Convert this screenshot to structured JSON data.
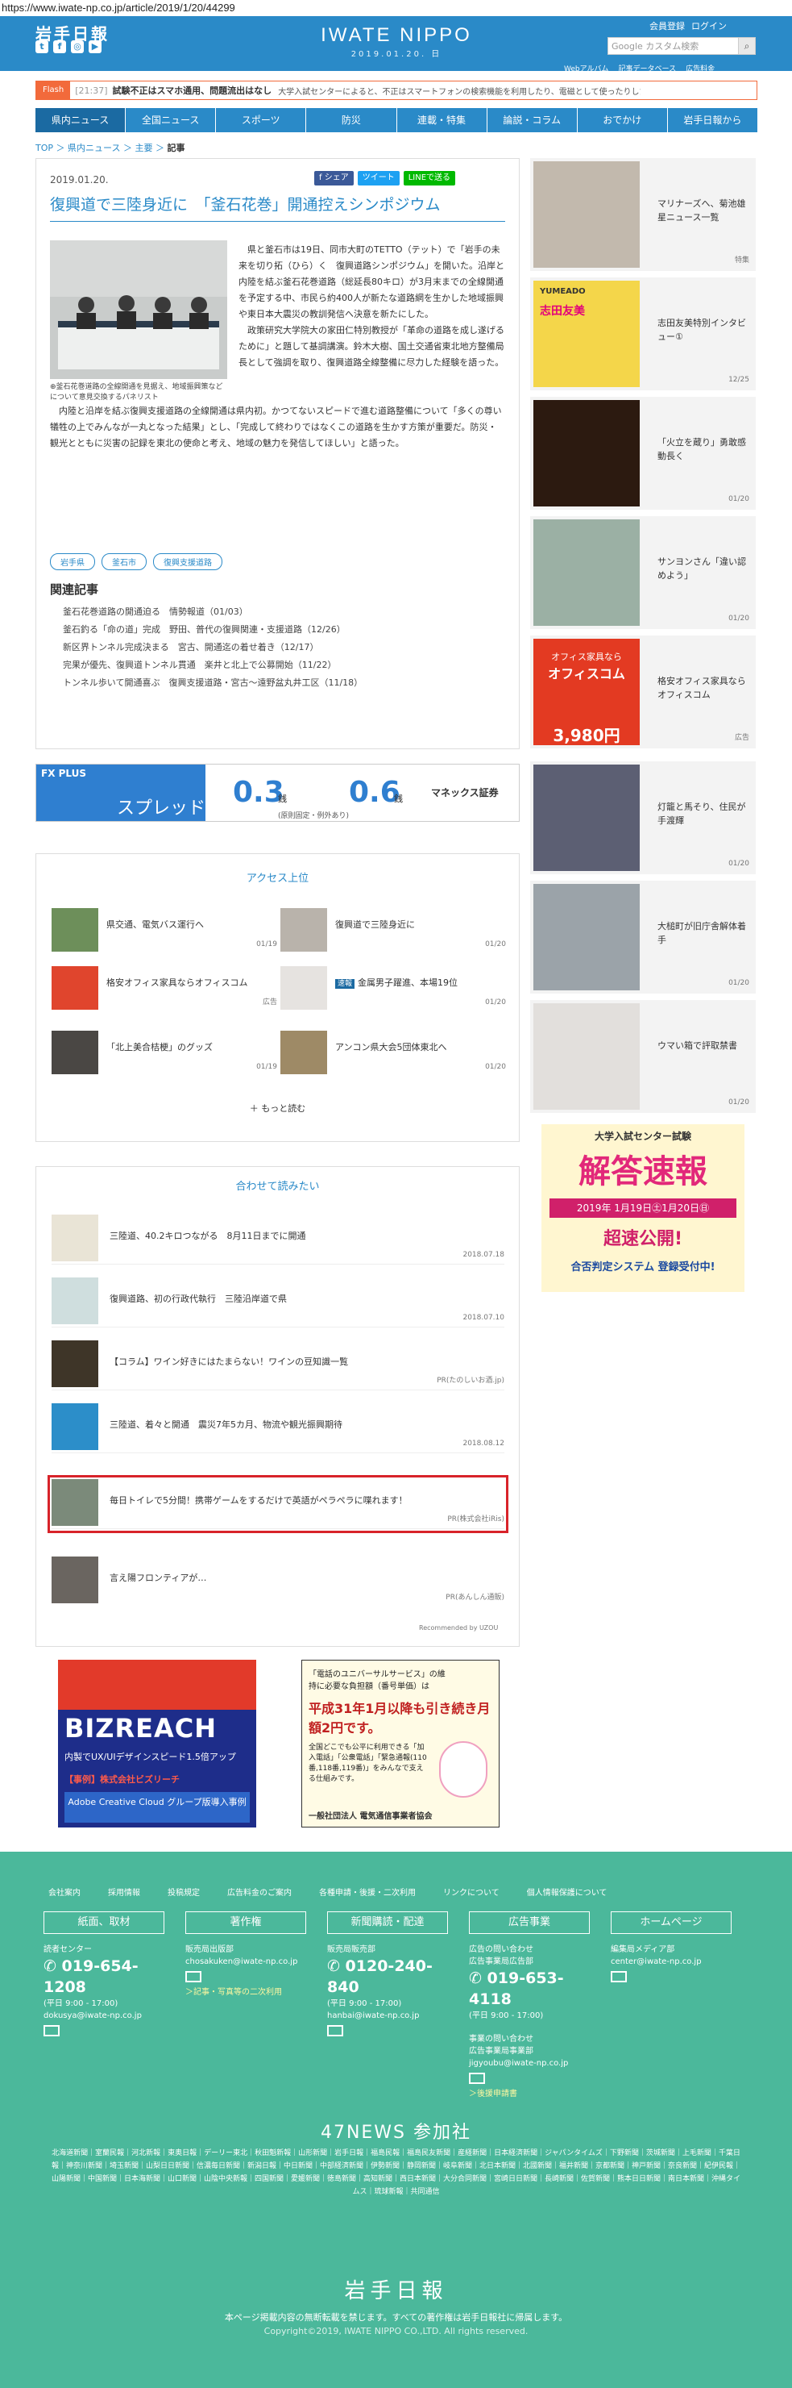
{
  "url_bar": "https://www.iwate-np.co.jp/article/2019/1/20/44299",
  "header": {
    "logo": "岩手日報",
    "site_logo": "IWATE NIPPO",
    "date": "2019.01.20. 日",
    "member": "会員登録",
    "login": "ログイン",
    "search_placeholder": "Google カスタム検索",
    "sub_links": [
      "Webアルバム",
      "記事データベース",
      "広告料金"
    ]
  },
  "flash": {
    "label": "Flash",
    "time": "[21:37]",
    "text": "試験不正はスマホ通用、問題流出はなし",
    "sub": "大学入試センターによると、不正はスマートフォンの検索機能を利用したり、電磁として使ったりしたもので、問題…"
  },
  "nav": [
    "県内ニュース",
    "全国ニュース",
    "スポーツ",
    "防災",
    "連載・特集",
    "論説・コラム",
    "おでかけ",
    "岩手日報から"
  ],
  "breadcrumb": {
    "top": "TOP",
    "l1": "県内ニュース",
    "l2": "主要",
    "cur": "記事"
  },
  "article": {
    "date": "2019.01.20.",
    "share_fb": "f シェア",
    "share_tw": "ツイート",
    "share_line": "LINEで送る",
    "title": "復興道で三陸身近に　「釜石花巻」開通控えシンポジウム",
    "caption": "釜石花巻道路の全線開通を見据え、地域振興策などについて意見交換するパネリスト",
    "body1": "県と釜石市は19日、同市大町のTETTO（テット）で「岩手の未来を切り拓（ひら）く　復興道路シンポジウム」を開いた。沿岸と内陸を結ぶ釜石花巻道路（総延長80キロ）が3月末までの全線開通を予定する中、市民ら約400人が新たな道路網を生かした地域振興や東日本大震災の教訓発信へ決意を新たにした。",
    "body1b": "政策研究大学院大の家田仁特別教授が「革命の道路を成し遂げるために」と題して基調講演。鈴木大樹、国土交通省東北地方整備局長として強調を取り、復興道路全線整備に尽力した経験を語った。",
    "body2": "内陸と沿岸を結ぶ復興支援道路の全線開通は県内初。かつてないスピードで進む道路整備について「多くの尊い犠牲の上でみんなが一丸となった結果」とし、「完成して終わりではなくこの道路を生かす方策が重要だ。防災・観光とともに災害の記録を東北の使命と考え、地域の魅力を発信してほしい」と語った。",
    "tags": [
      "岩手県",
      "釜石市",
      "復興支援道路"
    ],
    "related_title": "関連記事",
    "related": [
      "釜石花巻道路の開通迫る　情勢報道（01/03）",
      "釜石釣る「命の道」完成　野田、普代の復興関連・支援道路（12/26）",
      "新区界トンネル完成決まる　宮古、開通迄の着せ着き（12/17）",
      "完果が優先、復興道トンネル貫通　楽井と北上で公募開始（11/22）",
      "トンネル歩いて開通喜ぶ　復興支援道路・宮古～遠野盆丸井工区（11/18）"
    ]
  },
  "fx_ad": {
    "brand": "FX PLUS",
    "word": "スプレッド",
    "usd": "0.3",
    "eur": "0.6",
    "unit": "銭",
    "note": "(原則固定・例外あり)",
    "sec": "マネックス証券"
  },
  "access": {
    "title": "アクセス上位",
    "items": [
      {
        "t": "県交通、電気バス運行へ",
        "d": "01/19"
      },
      {
        "t": "復興道で三陸身近に",
        "d": "01/20"
      },
      {
        "t": "格安オフィス家具ならオフィスコム",
        "d": "広告"
      },
      {
        "t": "金属男子躍進、本場19位",
        "d": "01/20"
      },
      {
        "t": "「北上美合桔梗」のグッズ",
        "d": "01/19"
      },
      {
        "t": "アンコン県大会5団体東北へ",
        "d": "01/20"
      }
    ],
    "more": "もっと読む",
    "tag": "速報"
  },
  "recommend": {
    "title": "合わせて読みたい",
    "items": [
      {
        "t": "三陸道、40.2キロつながる　8月11日までに開通",
        "d": "2018.07.18"
      },
      {
        "t": "復興道路、初の行政代執行　三陸沿岸道で県",
        "d": "2018.07.10"
      },
      {
        "t": "【コラム】ワイン好きにはたまらない！ワインの豆知識一覧",
        "d": "PR(たのしいお酒.jp)"
      },
      {
        "t": "三陸道、着々と開通　震災7年5カ月、物流や観光振興期待",
        "d": "2018.08.12"
      },
      {
        "t": "毎日トイレで5分間！携帯ゲームをするだけで英語がペラペラに喋れます！",
        "d": "PR(株式会社iRis)"
      },
      {
        "t": "言え陽フロンティアが…",
        "d": "PR(あんしん通販)"
      }
    ],
    "by": "Recommended by UZOU"
  },
  "bottom_ads": {
    "a1_title": "BIZREACH",
    "a1_line1": "内製でUX/UIデザインスピード1.5倍アップ",
    "a1_line2": "【事例】株式会社ビズリーチ",
    "a1_line3": "Adobe Creative Cloud グループ版導入事例",
    "a2_line1": "「電話のユニバーサルサービス」の維持に必要な負担額（番号単価）は",
    "a2_line2": "平成31年1月以降も引き続き月額2円です。",
    "a2_line3": "全国どこでも公平に利用できる「加入電話」「公衆電話」「緊急通報(110番,118番,119番)」をみんなで支える仕組みです。",
    "a2_line4": "一般社団法人 電気通信事業者協会"
  },
  "sidebar": {
    "items": [
      {
        "t": "マリナーズへ、菊池雄星ニュース一覧",
        "d": "特集"
      },
      {
        "t": "志田友美特別インタビュー①",
        "d": "12/25"
      },
      {
        "t": "「火立を蔵り」勇敢感動長く",
        "d": "01/20"
      },
      {
        "t": "サンヨンさん「違い認めよう」",
        "d": "01/20"
      },
      {
        "t": "格安オフィス家具ならオフィスコム",
        "d": "広告"
      },
      {
        "t": "灯籠と馬そり、住民が手渡輝",
        "d": "01/20"
      },
      {
        "t": "大槌町が旧庁舎解体着手",
        "d": "01/20"
      },
      {
        "t": "ウマい箱で評取禁書",
        "d": "01/20"
      }
    ],
    "ad1": "YUMEADO",
    "ad1b": "志田友美",
    "ad2a": "オフィス家具なら",
    "ad2b": "オフィスコム",
    "ad2c": "3,980円",
    "center_ad": {
      "l1": "大学入試センター試験",
      "l2": "解答速報",
      "l3": "2019年 1月19日㊏1月20日㊐",
      "l4": "超速公開!",
      "l5": "合否判定システム 登録受付中!"
    }
  },
  "footer": {
    "links": [
      "会社案内",
      "採用情報",
      "投稿規定",
      "広告料金のご案内",
      "各種申請・後援・二次利用",
      "リンクについて",
      "個人情報保護について"
    ],
    "boxes": [
      "紙面、取材",
      "著作権",
      "新聞購読・配達",
      "広告事業",
      "ホームページ"
    ],
    "c1": {
      "h": "読者センター",
      "tel": "019-654-1208",
      "hrs": "(平日 9:00 - 17:00)",
      "mail": "dokusya@iwate-np.co.jp"
    },
    "c2": {
      "h": "販売局出版部",
      "mail": "chosakuken@iwate-np.co.jp",
      "link": "＞記事・写真等の二次利用"
    },
    "c3": {
      "h": "販売局販売部",
      "tel": "0120-240-840",
      "hrs": "(平日 9:00 - 17:00)",
      "mail": "hanbai@iwate-np.co.jp"
    },
    "c4": {
      "h": "広告の問い合わせ",
      "h2": "広告事業局広告部",
      "tel": "019-653-4118",
      "hrs": "(平日 9:00 - 17:00)",
      "h3": "事業の問い合わせ",
      "h4": "広告事業局事業部",
      "mail": "jigyoubu@iwate-np.co.jp",
      "link": "＞後援申請書"
    },
    "c5": {
      "h": "編集局メディア部",
      "mail": "center@iwate-np.co.jp"
    },
    "n47": "47NEWS 参加社",
    "papers": "北海道新聞｜室蘭民報｜河北新報｜東奥日報｜デーリー東北｜秋田魁新報｜山形新聞｜岩手日報｜福島民報｜福島民友新聞｜産経新聞｜日本経済新聞｜ジャパンタイムズ｜下野新聞｜茨城新聞｜上毛新聞｜千葉日報｜神奈川新聞｜埼玉新聞｜山梨日日新聞｜信濃毎日新聞｜新潟日報｜中日新聞｜中部経済新聞｜伊勢新聞｜静岡新聞｜岐阜新聞｜北日本新聞｜北國新聞｜福井新聞｜京都新聞｜神戸新聞｜奈良新聞｜紀伊民報｜山陽新聞｜中国新聞｜日本海新聞｜山口新聞｜山陰中央新報｜四国新聞｜愛媛新聞｜徳島新聞｜高知新聞｜西日本新聞｜大分合同新聞｜宮崎日日新聞｜長崎新聞｜佐賀新聞｜熊本日日新聞｜南日本新聞｜沖縄タイムス｜琉球新報｜共同通信",
    "logo": "岩手日報",
    "copy1": "本ページ掲載内容の無断転載を禁じます。すべての著作権は岩手日報社に帰属します。",
    "copy2": "Copyright©2019, IWATE NIPPO CO.,LTD. All rights reserved."
  },
  "colors": {
    "brand": "#2a8ac8",
    "footer": "#4bb89b",
    "flash": "#f26a3b",
    "highlight": "#d8232a"
  }
}
